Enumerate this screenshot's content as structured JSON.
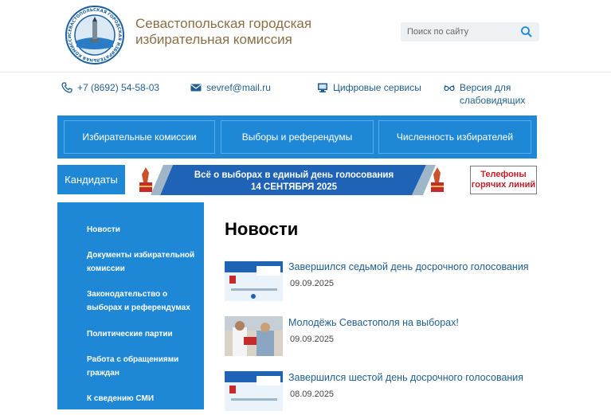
{
  "header": {
    "org_title": "Севастопольская городская избирательная комиссия",
    "logo_text": "СЕВАСТОПОЛЬСКАЯ ГОРОДСКАЯ ИЗБИРАТЕЛЬНАЯ КОМИССИЯ",
    "search_placeholder": "Поиск по сайту"
  },
  "contacts": {
    "phone": "+7 (8692) 54-58-03",
    "email": "sevref@mail.ru",
    "digital": "Цифровые сервисы",
    "low_vision": "Версия для слабовидящих"
  },
  "menu": {
    "items": [
      {
        "label": "Избирательные комиссии"
      },
      {
        "label": "Выборы и референдумы"
      },
      {
        "label": "Численность избирателей"
      }
    ]
  },
  "banner": {
    "candidates_label": "Кандидаты",
    "line1": "Всё о выборах в единый день голосования",
    "line2": "14 СЕНТЯБРЯ 2025",
    "hotline_line1": "Телефоны",
    "hotline_line2": "горячих линий"
  },
  "sidebar": {
    "items": [
      {
        "label": "Новости"
      },
      {
        "label": "Документы избирательной комиссии"
      },
      {
        "label": "Законодательство о выборах и референдумах"
      },
      {
        "label": "Политические партии"
      },
      {
        "label": "Работа с обращениями граждан"
      },
      {
        "label": "К сведению СМИ"
      }
    ]
  },
  "main": {
    "title": "Новости",
    "news": [
      {
        "title": "Завершился седьмой день досрочного голосования",
        "date": "09.09.2025"
      },
      {
        "title": "Молодёжь Севастополя на выборах!",
        "date": "09.09.2025"
      },
      {
        "title": "Завершился шестой день досрочного голосования",
        "date": "08.09.2025"
      }
    ]
  },
  "colors": {
    "accent": "#1e88d6",
    "link": "#1f5d8f",
    "brand_text": "#8a6e46",
    "hotline": "#c01e28"
  }
}
